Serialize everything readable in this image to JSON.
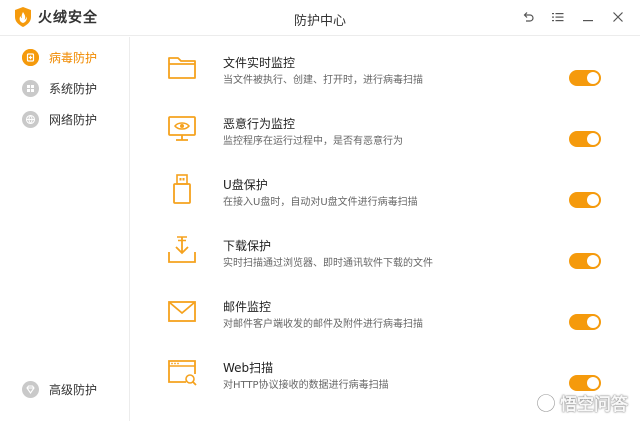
{
  "app": {
    "brand_name": "火绒安全",
    "window_title": "防护中心"
  },
  "window_controls": [
    {
      "name": "back-button",
      "icon": "undo-arrow-icon"
    },
    {
      "name": "menu-button",
      "icon": "list-menu-icon"
    },
    {
      "name": "minimize-button",
      "icon": "minimize-icon"
    },
    {
      "name": "close-button",
      "icon": "close-icon"
    }
  ],
  "sidebar": {
    "items": [
      {
        "label": "病毒防护",
        "icon": "plus-shield-icon",
        "active": true
      },
      {
        "label": "系统防护",
        "icon": "windows-icon",
        "active": false
      },
      {
        "label": "网络防护",
        "icon": "globe-icon",
        "active": false
      }
    ],
    "bottom_item": {
      "label": "高级防护",
      "icon": "diamond-icon"
    }
  },
  "features": [
    {
      "title": "文件实时监控",
      "desc": "当文件被执行、创建、打开时，进行病毒扫描",
      "icon": "folder-icon",
      "enabled": true
    },
    {
      "title": "恶意行为监控",
      "desc": "监控程序在运行过程中，是否有恶意行为",
      "icon": "monitor-eye-icon",
      "enabled": true
    },
    {
      "title": "U盘保护",
      "desc": "在接入U盘时，自动对U盘文件进行病毒扫描",
      "icon": "usb-drive-icon",
      "enabled": true
    },
    {
      "title": "下载保护",
      "desc": "实时扫描通过浏览器、即时通讯软件下载的文件",
      "icon": "download-tray-icon",
      "enabled": true
    },
    {
      "title": "邮件监控",
      "desc": "对邮件客户端收发的邮件及附件进行病毒扫描",
      "icon": "mail-icon",
      "enabled": true
    },
    {
      "title": "Web扫描",
      "desc": "对HTTP协议接收的数据进行病毒扫描",
      "icon": "web-scan-icon",
      "enabled": true
    }
  ],
  "colors": {
    "accent": "#f59a0c",
    "active_text": "#f08a00",
    "icon_orange": "#f5a21e"
  },
  "watermark": {
    "text": "悟空问答"
  }
}
